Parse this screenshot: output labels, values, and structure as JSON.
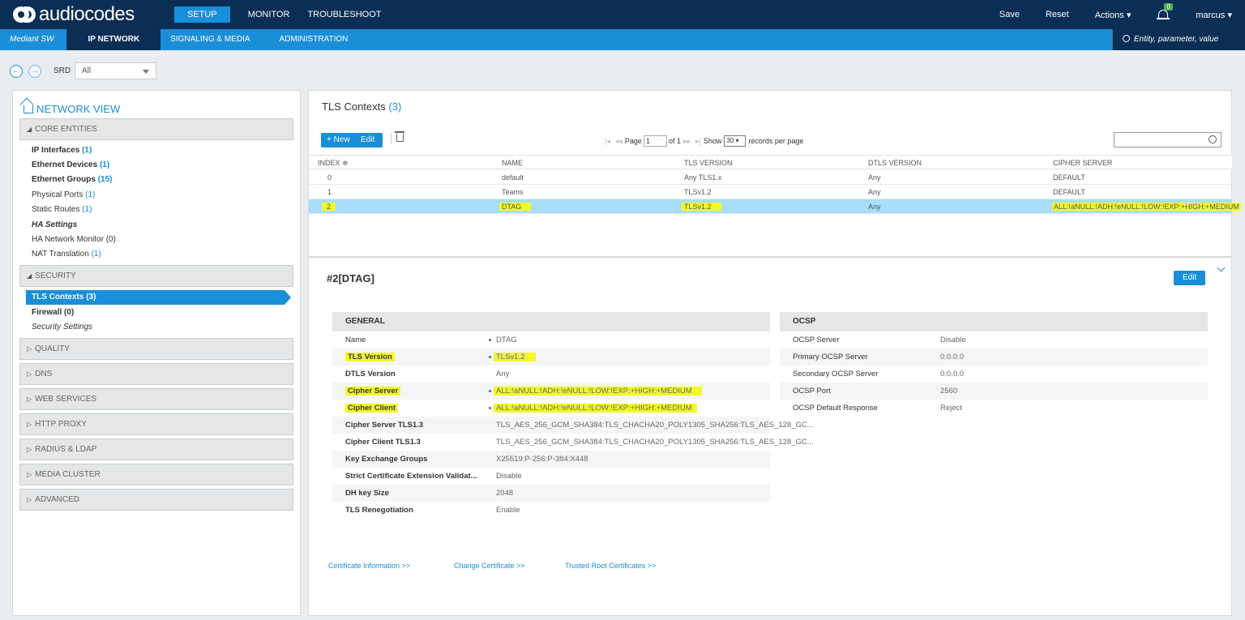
{
  "header": {
    "logo_text": "audiocodes",
    "tabs": [
      "SETUP",
      "MONITOR",
      "TROUBLESHOOT"
    ],
    "actions": {
      "save": "Save",
      "reset": "Reset",
      "actions": "Actions ▾",
      "user": "marcus ▾"
    },
    "notification_count": "0"
  },
  "subnav": {
    "product": "Mediant SW",
    "tabs": [
      "IP NETWORK",
      "SIGNALING & MEDIA",
      "ADMINISTRATION"
    ],
    "search_placeholder": "Entity, parameter, value"
  },
  "srd": {
    "label": "SRD",
    "value": "All"
  },
  "sidebar": {
    "title": "NETWORK VIEW",
    "core_entities": "CORE ENTITIES",
    "core_items": [
      {
        "label": "IP Interfaces",
        "count": "(1)"
      },
      {
        "label": "Ethernet Devices",
        "count": "(1)"
      },
      {
        "label": "Ethernet Groups",
        "count": "(15)"
      },
      {
        "label": "Physical Ports",
        "count": "(1)"
      },
      {
        "label": "Static Routes",
        "count": "(1)"
      },
      {
        "label": "HA Settings",
        "count": ""
      },
      {
        "label": "HA Network Monitor",
        "count": "(0)"
      },
      {
        "label": "NAT Translation",
        "count": "(1)"
      }
    ],
    "security": "SECURITY",
    "security_items": [
      {
        "label": "TLS Contexts (3)"
      },
      {
        "label": "Firewall (0)"
      },
      {
        "label": "Security Settings"
      }
    ],
    "sections": [
      "QUALITY",
      "DNS",
      "WEB SERVICES",
      "HTTP PROXY",
      "RADIUS & LDAP",
      "MEDIA CLUSTER",
      "ADVANCED"
    ]
  },
  "table": {
    "title": "TLS Contexts",
    "count": "(3)",
    "new_label": "+ New",
    "edit_label": "Edit",
    "pager": {
      "page": "Page",
      "page_value": "1",
      "of": "of 1",
      "show": "Show",
      "per_page": "30",
      "records": "records per page"
    },
    "columns": [
      "INDEX ≑",
      "NAME",
      "TLS VERSION",
      "DTLS VERSION",
      "CIPHER SERVER"
    ],
    "rows": [
      [
        "0",
        "default",
        "Any TLS1.x",
        "Any",
        "DEFAULT"
      ],
      [
        "1",
        "Teams",
        "TLSv1.2",
        "Any",
        "DEFAULT"
      ],
      [
        "2",
        "DTAG",
        "TLSv1.2",
        "Any",
        "ALL:!aNULL:!ADH:!eNULL:!LOW:!EXP:+HIGH:+MEDIUM"
      ]
    ]
  },
  "detail": {
    "title": "#2[DTAG]",
    "edit_label": "Edit",
    "general_title": "GENERAL",
    "general": [
      {
        "label": "Name",
        "value": "DTAG"
      },
      {
        "label": "TLS Version",
        "value": "TLSv1.2"
      },
      {
        "label": "DTLS Version",
        "value": "Any"
      },
      {
        "label": "Cipher Server",
        "value": "ALL:!aNULL:!ADH:!eNULL:!LOW:!EXP:+HIGH:+MEDIUM"
      },
      {
        "label": "Cipher Client",
        "value": "ALL:!aNULL:!ADH:!eNULL:!LOW:!EXP:+HIGH:+MEDIUM"
      },
      {
        "label": "Cipher Server TLS1.3",
        "value": "TLS_AES_256_GCM_SHA384:TLS_CHACHA20_POLY1305_SHA256:TLS_AES_128_GC..."
      },
      {
        "label": "Cipher Client TLS1.3",
        "value": "TLS_AES_256_GCM_SHA384:TLS_CHACHA20_POLY1305_SHA256:TLS_AES_128_GC..."
      },
      {
        "label": "Key Exchange Groups",
        "value": "X25519:P-256:P-384:X448"
      },
      {
        "label": "Strict Certificate Extension Validat...",
        "value": "Disable"
      },
      {
        "label": "DH key Size",
        "value": "2048"
      },
      {
        "label": "TLS Renegotiation",
        "value": "Enable"
      }
    ],
    "ocsp_title": "OCSP",
    "ocsp": [
      {
        "label": "OCSP Server",
        "value": "Disable"
      },
      {
        "label": "Primary OCSP Server",
        "value": "0.0.0.0"
      },
      {
        "label": "Secondary OCSP Server",
        "value": "0.0.0.0"
      },
      {
        "label": "OCSP Port",
        "value": "2560"
      },
      {
        "label": "OCSP Default Response",
        "value": "Reject"
      }
    ],
    "links": [
      "Certificate Information >>",
      "Change Certificate >>",
      "Trusted Root Certificates >>"
    ]
  },
  "colors": {
    "brand_dark": "#0b2e55",
    "accent": "#1a8ed8",
    "highlight": "#f3fa26",
    "selected_row": "#a9defa"
  }
}
